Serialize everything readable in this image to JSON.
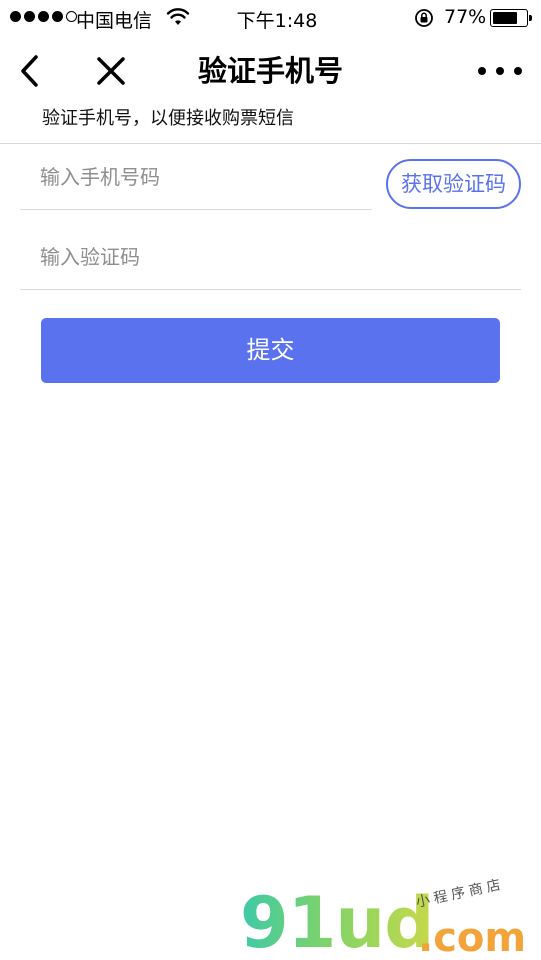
{
  "status_bar": {
    "carrier": "中国电信",
    "time": "下午1:48",
    "battery_percent": "77%",
    "battery_level": 0.77,
    "signal_bars_filled": 4,
    "signal_bars_total": 5
  },
  "nav": {
    "title": "验证手机号",
    "back_icon": "chevron-left-icon",
    "close_icon": "close-icon",
    "more_icon": "more-dots-icon"
  },
  "subtitle": "验证手机号，以便接收购票短信",
  "form": {
    "phone_placeholder": "输入手机号码",
    "phone_value": "",
    "code_placeholder": "输入验证码",
    "code_value": "",
    "get_code_label": "获取验证码",
    "submit_label": "提交"
  },
  "watermark": {
    "logo": "91ud",
    "domain": ".com",
    "tagline": "小程序商店"
  },
  "colors": {
    "accent": "#5b72ee",
    "divider": "#d9d9d9",
    "placeholder": "#8e8e8e"
  }
}
